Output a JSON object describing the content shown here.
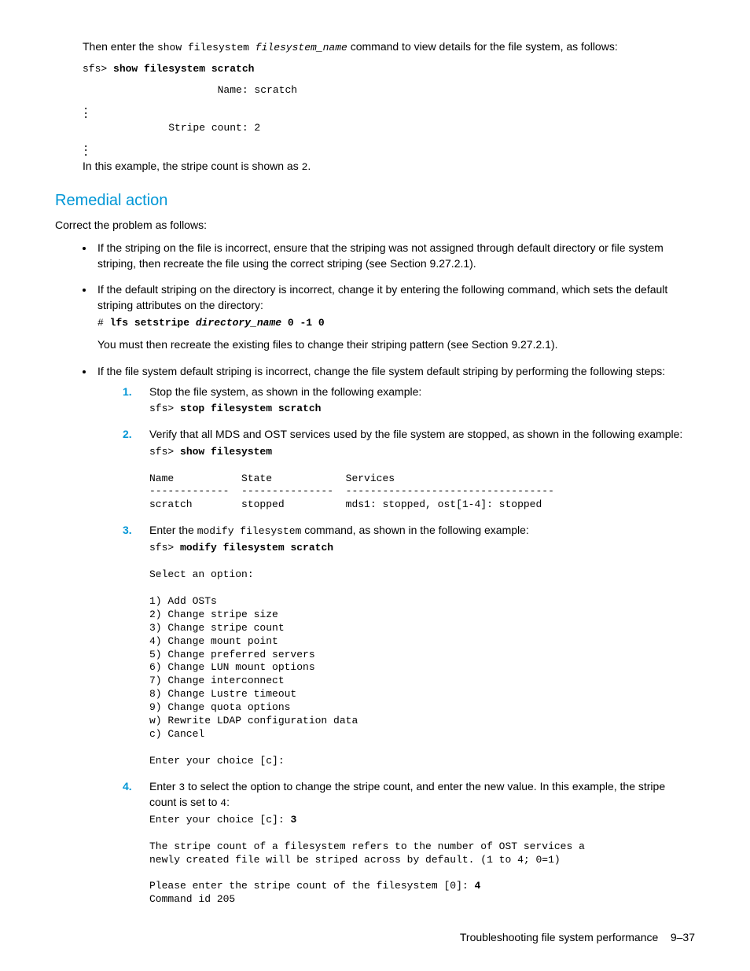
{
  "intro": {
    "p1_a": "Then enter the ",
    "p1_cmd1": "show filesystem",
    "p1_cmd2": " filesystem_name",
    "p1_b": " command to view details for the file system, as follows:",
    "code1_line1": "sfs> ",
    "code1_bold": "show filesystem scratch",
    "code1_name": "                      Name: scratch",
    "code1_stripe": "              Stripe count: 2",
    "p2_a": "In this example, the stripe count is shown as ",
    "p2_code": "2",
    "p2_b": "."
  },
  "heading": "Remedial action",
  "p3": "Correct the problem as follows:",
  "bullet1": "If the striping on the file is incorrect, ensure that the striping was not assigned through default directory or file system striping, then recreate the file using the correct striping (see Section 9.27.2.1).",
  "bullet2": {
    "text": "If the default striping on the directory is incorrect, change it by entering the following command, which sets the default striping attributes on the directory:",
    "code_prompt": "# ",
    "code_bold": "lfs setstripe ",
    "code_italic": "directory_name",
    "code_rest": " 0 -1 0",
    "after": "You must then recreate the existing files to change their striping pattern (see Section 9.27.2.1)."
  },
  "bullet3": {
    "text": "If the file system default striping is incorrect, change the file system default striping by performing the following steps:",
    "step1": {
      "text": "Stop the file system, as shown in the following example:",
      "code_a": "sfs> ",
      "code_b": "stop filesystem scratch"
    },
    "step2": {
      "text": "Verify that all MDS and OST services used by the file system are stopped, as shown in the following example:",
      "code_a": "sfs> ",
      "code_b": "show filesystem",
      "out": "Name           State            Services\n-------------  ---------------  ----------------------------------\nscratch        stopped          mds1: stopped, ost[1-4]: stopped"
    },
    "step3": {
      "text_a": "Enter the ",
      "text_cmd": "modify filesystem",
      "text_b": " command, as shown in the following example:",
      "code_a": "sfs> ",
      "code_b": "modify filesystem scratch",
      "out": "Select an option:\n\n1) Add OSTs\n2) Change stripe size\n3) Change stripe count\n4) Change mount point\n5) Change preferred servers\n6) Change LUN mount options\n7) Change interconnect\n8) Change Lustre timeout\n9) Change quota options\nw) Rewrite LDAP configuration data\nc) Cancel\n\nEnter your choice [c]:"
    },
    "step4": {
      "text_a": "Enter ",
      "text_code1": "3",
      "text_b": " to select the option to change the stripe count, and enter the new value. In this example, the stripe count is set to ",
      "text_code2": "4",
      "text_c": ":",
      "out_a": "Enter your choice [c]: ",
      "out_a_bold": "3",
      "out_mid": "The stripe count of a filesystem refers to the number of OST services a\nnewly created file will be striped across by default. (1 to 4; 0=1)",
      "out_b": "Please enter the stripe count of the filesystem [0]: ",
      "out_b_bold": "4",
      "out_c": "Command id 205"
    }
  },
  "footer_text": "Troubleshooting file system performance",
  "footer_page": "9–37"
}
